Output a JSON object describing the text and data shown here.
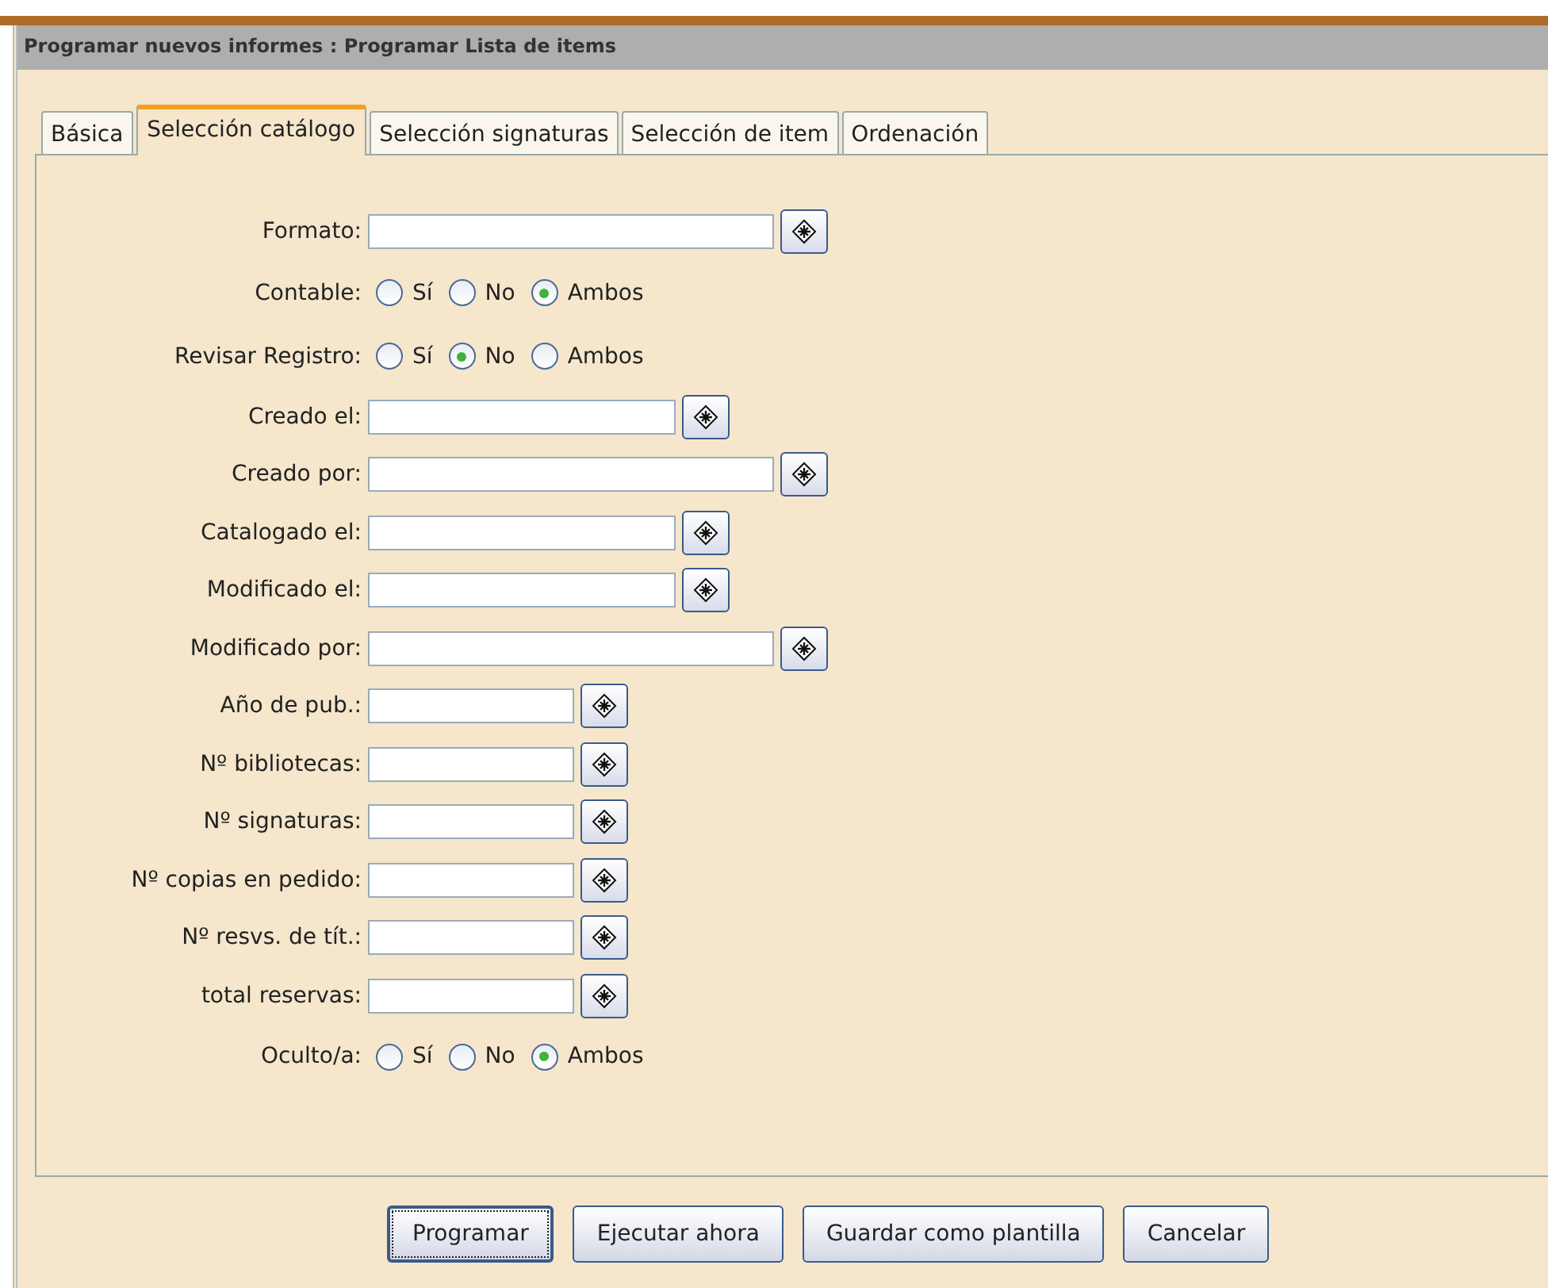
{
  "window": {
    "title": "Programar nuevos informes : Programar Lista de items"
  },
  "tabs": [
    {
      "label": "Básica",
      "selected": false
    },
    {
      "label": "Selección catálogo",
      "selected": true
    },
    {
      "label": "Selección signaturas",
      "selected": false
    },
    {
      "label": "Selección de item",
      "selected": false
    },
    {
      "label": "Ordenación",
      "selected": false
    }
  ],
  "rows": [
    {
      "kind": "long",
      "label": "Formato:"
    },
    {
      "kind": "radio",
      "label": "Contable:",
      "options": [
        {
          "label": "Sí",
          "selected": false
        },
        {
          "label": "No",
          "selected": false
        },
        {
          "label": "Ambos",
          "selected": true
        }
      ]
    },
    {
      "kind": "radio",
      "label": "Revisar Registro:",
      "options": [
        {
          "label": "Sí",
          "selected": false
        },
        {
          "label": "No",
          "selected": true
        },
        {
          "label": "Ambos",
          "selected": false
        }
      ]
    },
    {
      "kind": "medium",
      "label": "Creado el:"
    },
    {
      "kind": "long",
      "label": "Creado por:"
    },
    {
      "kind": "medium",
      "label": "Catalogado el:"
    },
    {
      "kind": "medium",
      "label": "Modificado el:"
    },
    {
      "kind": "long",
      "label": "Modificado por:"
    },
    {
      "kind": "short",
      "label": "Año de pub.:"
    },
    {
      "kind": "short",
      "label": "Nº bibliotecas:"
    },
    {
      "kind": "short",
      "label": "Nº signaturas:"
    },
    {
      "kind": "short",
      "label": "Nº copias en pedido:"
    },
    {
      "kind": "short",
      "label": "Nº resvs. de tít.:"
    },
    {
      "kind": "short",
      "label": "total reservas:"
    },
    {
      "kind": "radio",
      "label": "Oculto/a:",
      "options": [
        {
          "label": "Sí",
          "selected": false
        },
        {
          "label": "No",
          "selected": false
        },
        {
          "label": "Ambos",
          "selected": true
        }
      ]
    }
  ],
  "buttons": [
    {
      "label": "Programar",
      "focused": true
    },
    {
      "label": "Ejecutar ahora",
      "focused": false
    },
    {
      "label": "Guardar como plantilla",
      "focused": false
    },
    {
      "label": "Cancelar",
      "focused": false
    }
  ]
}
